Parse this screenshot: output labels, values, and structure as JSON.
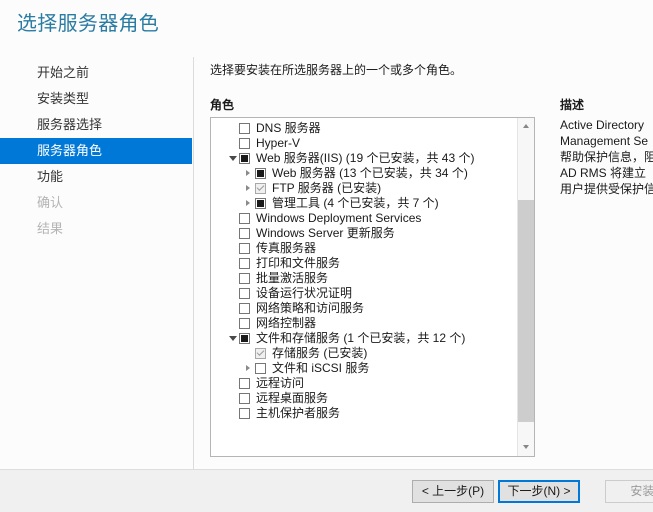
{
  "title": "选择服务器角色",
  "accent_color": "#0078d7",
  "title_color": "#2a7ca3",
  "nav": {
    "items": [
      {
        "label": "开始之前",
        "state": "normal"
      },
      {
        "label": "安装类型",
        "state": "normal"
      },
      {
        "label": "服务器选择",
        "state": "normal"
      },
      {
        "label": "服务器角色",
        "state": "selected"
      },
      {
        "label": "功能",
        "state": "normal"
      },
      {
        "label": "确认",
        "state": "disabled"
      },
      {
        "label": "结果",
        "state": "disabled"
      }
    ]
  },
  "content": {
    "instruction": "选择要安装在所选服务器上的一个或多个角色。",
    "roles_heading": "角色",
    "description_heading": "描述",
    "description_lines": [
      "Active Directory",
      "Management Se",
      "帮助保护信息，阻",
      "AD RMS 将建立",
      "用户提供受保护信"
    ]
  },
  "roles": [
    {
      "label": "DNS 服务器",
      "indent": 0,
      "checkbox": "unchecked",
      "expander": "none"
    },
    {
      "label": "Hyper-V",
      "indent": 0,
      "checkbox": "unchecked",
      "expander": "none"
    },
    {
      "label": "Web 服务器(IIS) (19 个已安装，共 43 个)",
      "indent": 0,
      "checkbox": "partial",
      "expander": "expanded"
    },
    {
      "label": "Web 服务器 (13 个已安装，共 34 个)",
      "indent": 1,
      "checkbox": "partial",
      "expander": "collapsed"
    },
    {
      "label": "FTP 服务器 (已安装)",
      "indent": 1,
      "checkbox": "checked-disabled",
      "expander": "collapsed"
    },
    {
      "label": "管理工具 (4 个已安装，共 7 个)",
      "indent": 1,
      "checkbox": "partial",
      "expander": "collapsed"
    },
    {
      "label": "Windows Deployment Services",
      "indent": 0,
      "checkbox": "unchecked",
      "expander": "none"
    },
    {
      "label": "Windows Server 更新服务",
      "indent": 0,
      "checkbox": "unchecked",
      "expander": "none"
    },
    {
      "label": "传真服务器",
      "indent": 0,
      "checkbox": "unchecked",
      "expander": "none"
    },
    {
      "label": "打印和文件服务",
      "indent": 0,
      "checkbox": "unchecked",
      "expander": "none"
    },
    {
      "label": "批量激活服务",
      "indent": 0,
      "checkbox": "unchecked",
      "expander": "none"
    },
    {
      "label": "设备运行状况证明",
      "indent": 0,
      "checkbox": "unchecked",
      "expander": "none"
    },
    {
      "label": "网络策略和访问服务",
      "indent": 0,
      "checkbox": "unchecked",
      "expander": "none"
    },
    {
      "label": "网络控制器",
      "indent": 0,
      "checkbox": "unchecked",
      "expander": "none"
    },
    {
      "label": "文件和存储服务 (1 个已安装，共 12 个)",
      "indent": 0,
      "checkbox": "partial",
      "expander": "expanded"
    },
    {
      "label": "存储服务 (已安装)",
      "indent": 1,
      "checkbox": "checked-disabled",
      "expander": "none"
    },
    {
      "label": "文件和 iSCSI 服务",
      "indent": 1,
      "checkbox": "unchecked",
      "expander": "collapsed"
    },
    {
      "label": "远程访问",
      "indent": 0,
      "checkbox": "unchecked",
      "expander": "none"
    },
    {
      "label": "远程桌面服务",
      "indent": 0,
      "checkbox": "unchecked",
      "expander": "none"
    },
    {
      "label": "主机保护者服务",
      "indent": 0,
      "checkbox": "unchecked",
      "expander": "none"
    }
  ],
  "scrollbar": {
    "up_arrow": "chevron-up",
    "down_arrow": "chevron-down"
  },
  "footer": {
    "previous": "< 上一步(P)",
    "next": "下一步(N) >",
    "install": "安装(I"
  }
}
